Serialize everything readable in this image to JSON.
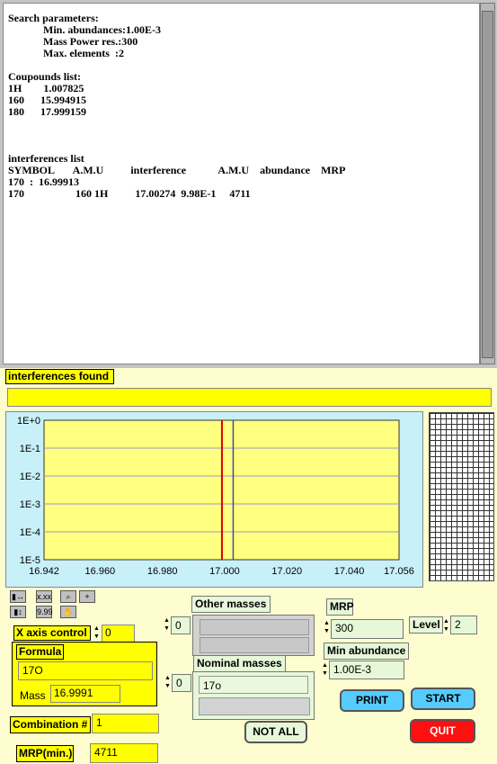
{
  "console": {
    "lines": [
      "Search parameters:",
      "             Min. abundances:1.00E-3",
      "             Mass Power res.:300",
      "             Max. elements  :2",
      "",
      "Coupounds list:",
      "1H        1.007825",
      "160      15.994915",
      "180      17.999159",
      "",
      "",
      "",
      "interferences list",
      "SYMBOL       A.M.U          interference            A.M.U    abundance    MRP",
      "170  :  16.99913",
      "170                   160 1H          17.00274  9.98E-1     4711"
    ]
  },
  "interferences": {
    "label": "interferences found",
    "value": ""
  },
  "chart_data": {
    "type": "line",
    "title": "",
    "xlabel": "",
    "ylabel": "",
    "x_ticks": [
      "16.942",
      "16.960",
      "16.980",
      "17.000",
      "17.020",
      "17.040",
      "17.056"
    ],
    "y_ticks": [
      "1E+0",
      "1E-1",
      "1E-2",
      "1E-3",
      "1E-4",
      "1E-5"
    ],
    "xlim": [
      16.942,
      17.056
    ],
    "ylim": [
      -5,
      0
    ],
    "y_scale": "log",
    "grid": true,
    "vlines": [
      {
        "x": 16.99913,
        "color": "#dd0000"
      },
      {
        "x": 17.00274,
        "color": "#3a50a0"
      }
    ]
  },
  "controls": {
    "x_axis_label": "X axis control",
    "x_axis_value": "0",
    "formula_label": "Formula",
    "formula_value": "17O",
    "mass_label": "Mass",
    "mass_value": "16.9991",
    "combination_label": "Combination #",
    "combination_value": "1",
    "mrp_min_label": "MRP(min.)",
    "mrp_min_value": "4711",
    "other_masses_label": "Other masses",
    "other_spin_value": "0",
    "nominal_masses_label": "Nominal masses",
    "nominal_spin_value": "0",
    "nominal_value": "17o",
    "not_all_label": "NOT ALL",
    "mrp_label": "MRP",
    "mrp_value": "300",
    "level_label": "Level",
    "level_value": "2",
    "min_abundance_label": "Min abundance",
    "min_abundance_value": "1.00E-3",
    "print_label": "PRINT",
    "start_label": "START",
    "quit_label": "QUIT",
    "colors": {
      "print": "#55ccff",
      "start": "#55ccff",
      "quit": "#ff1010"
    }
  }
}
